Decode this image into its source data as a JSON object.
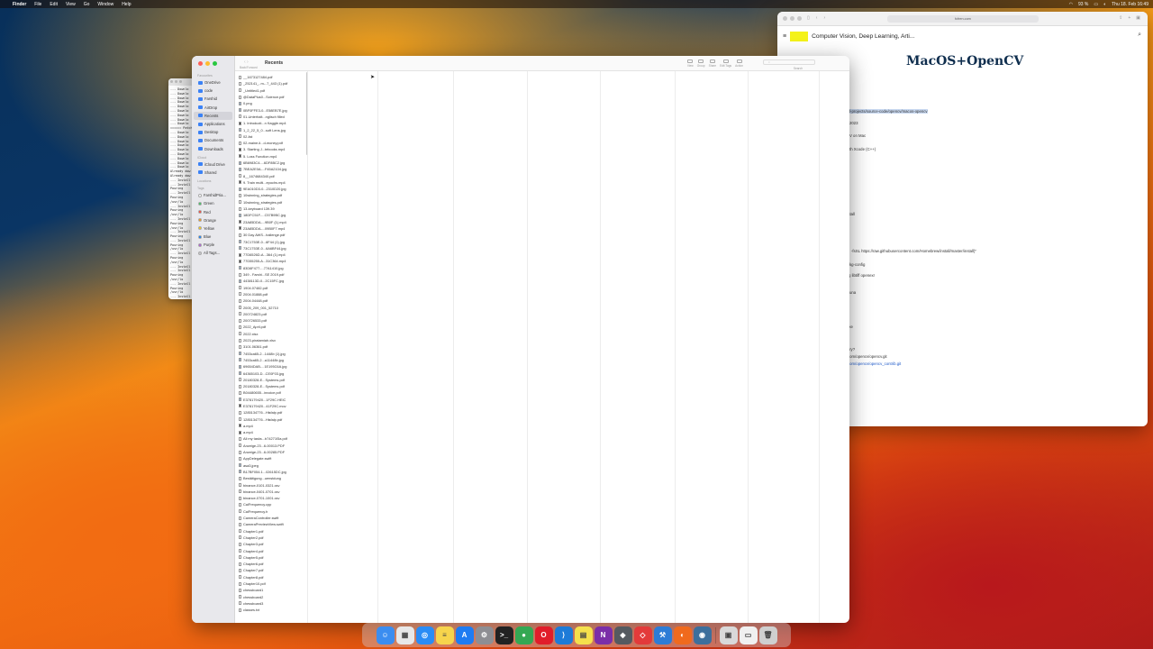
{
  "menubar": {
    "app": "Finder",
    "items": [
      "File",
      "Edit",
      "View",
      "Go",
      "Window",
      "Help"
    ],
    "battery": "93 %",
    "clock": "Thu 18. Feb 16:49"
  },
  "terminal": {
    "lines": [
      "--- Downlo",
      "--- Downlo",
      "--- Downlo",
      "--- Downlo",
      "--- Downlo",
      "--- Downlo",
      "--- Downlo",
      "--- Downlo",
      "--- Downlo",
      "====== Patchi",
      "--- Downlo",
      "--- Downlo",
      "--- Downlo",
      "--- Downlo",
      "--- Downlo",
      "--- Downlo",
      "--- Downlo",
      "--- Downlo",
      "--- Downlo",
      "Already dow",
      "Already dow",
      "--- Install",
      "--- Install",
      "Pouring",
      "--- Install",
      "Pouring",
      "/usr/lo",
      "--- Install",
      "Pouring",
      "/usr/lo",
      "--- Install",
      "Pouring",
      "/usr/lo",
      "--- Install",
      "Pouring",
      "--- Install",
      "Pouring",
      "/usr/lo",
      "--- Install",
      "Pouring",
      "/usr/lo",
      "--- Install",
      "--- Install",
      "Pouring",
      "/usr/lo",
      "--- Install",
      "Pouring",
      "/usr/lo",
      "--- Install",
      "Pouring"
    ]
  },
  "finder": {
    "title": "Recents",
    "nav_label": "Back/Forward",
    "toolbar": [
      "View",
      "Group",
      "Share",
      "Edit Tags",
      "Action"
    ],
    "search_label": "Search",
    "sidebar": {
      "favourites_header": "Favourites",
      "favourites": [
        "OneDrive",
        "code",
        "Farshid",
        "AirDrop",
        "Recents",
        "Applications",
        "Desktop",
        "Documents",
        "Downloads"
      ],
      "icloud_header": "iCloud",
      "icloud": [
        "iCloud Drive",
        "Shared"
      ],
      "locations_header": "Locations",
      "tags_header": "Tags",
      "tags": [
        {
          "label": "FarshidPria...",
          "color": "#ffffff"
        },
        {
          "label": "Green",
          "color": "#34c759"
        },
        {
          "label": "Red",
          "color": "#ff3b30"
        },
        {
          "label": "Orange",
          "color": "#ff9500"
        },
        {
          "label": "Yellow",
          "color": "#ffcc00"
        },
        {
          "label": "Blue",
          "color": "#007aff"
        },
        {
          "label": "Purple",
          "color": "#af52de"
        },
        {
          "label": "All Tags...",
          "color": "#c7c7cc"
        }
      ]
    },
    "files": [
      "__1673127484.pdf",
      "_252141_..m-..7_443 (1).pdf",
      "_Untitled1.pdf",
      "@DataPlus0...Science.pdf",
      "0.png",
      "0BF0FFE3-0...E58EB7E.jpg",
      "01-Unterhalt...nglisch filled",
      "1. Introducti...n Kaggle.mp4",
      "1_2_22_5_0...soft Lens.jpg",
      "02-list",
      "02-maine-li...d-money.pdf",
      "3. Starting J...tebooks.mp4",
      "5. Loss Function.mp4",
      "6B6983C4-...6DF8BC2.jpg",
      "7BEA2E0A-...F45A2104.jpg",
      "8__1674684340.pdf",
      "9. Train multi...epochs.mp4",
      "9EA010D3-0...2310D20.jpg",
      "10winning_strategies.pdf",
      "10winning_strategies.pdf",
      "13-keyboard 139.39",
      "18DFC51F-...C57B9BC.jpg",
      "23A85DDA-...9B0F (1).mp4",
      "23A85DDA-...09B0F7.mp4",
      "30 Day AWS...hallenge.pdf",
      "73C1753E-0...6F44 (1).jpg",
      "73C1753E-0...6A6BF44.jpg",
      "77D6526D-A...364 (1).mp4",
      "77D55255-A...31C364.mp4",
      "83D6F477-...77A1410.jpg",
      "349 - Farshi...SE 2019.pdf",
      "4438113D-0...2C15FC.jpg",
      "1904.07482.pdf",
      "2004.01888.pdf",
      "2004.04448.pdf",
      "2005_209_001_52710",
      "200724823.pdf",
      "200726533.pdf",
      "2022_April.pdf",
      "2022.xlsx",
      "2023-piratamiah.xlsx",
      "3101.06361.pdf",
      "7453ca65-2...1448b (1).jpg",
      "7453ca65-2...a11448b.jpg",
      "69654DAB-...1E195C6A.jpg",
      "64365103-D...CE0F03.jpg",
      "20180328-E...Systems.pdf",
      "20180328-E...Systems.pdf",
      "B04480655...invoice.pdf",
      "E378179420...1F29C.HEIC",
      "E378179420...41F29C.mov",
      "1285134776...Hisfalp.pdf",
      "1285134776...Hisfalp.pdf",
      "a.mp4",
      "a.mp4",
      "All my tasks...b74271f3a.pdf",
      "Anzeige-23...6-00013.PDF",
      "Anzeige-23...6-00285.PDF",
      "AppDelegate.swift",
      "asa3.jpeg",
      "B17BF054-1...02615DC.jpg",
      "Bestätigung...uenstdung",
      "binance-0101-0321.csv",
      "binance-0401-0701.csv",
      "binance-0701-1001.csv",
      "CalFrequency.cpp",
      "CalFrequency.h",
      "CameraController.swift",
      "CameraPreviewView.swift",
      "Chapter1.pdf",
      "Chapter2.pdf",
      "Chapter3.pdf",
      "Chapter4.pdf",
      "Chapter5.pdf",
      "Chapter6.pdf",
      "Chapter7.pdf",
      "Chapter8.pdf",
      "Chapter10.pdf",
      "chessboard1",
      "chessboard2",
      "chessboard3",
      "classes.txt"
    ]
  },
  "safari": {
    "url": "fcfren.com",
    "site_title": "Computer Vision, Deep Learning, Arti...",
    "heading": "MacOS+OpenCV",
    "fragments": [
      {
        "text": "/topics-and-projects/source-code/opencv/macos-opencv",
        "style": "hl"
      },
      {
        "text": "2023",
        "style": ""
      },
      {
        "text": "V on Mac",
        "style": ""
      },
      {
        "text": "th Xcode (C++)",
        "style": ""
      },
      {
        "text": "se",
        "style": ""
      },
      {
        "text": "install",
        "style": ""
      },
      {
        "text": "-fsSL https://raw.githubusercontent.com/Homebrew/install/master/install)\"",
        "style": "mix"
      },
      {
        "text": "kg-config",
        "style": ""
      },
      {
        "text": "g libtiff openexr",
        "style": ""
      },
      {
        "text": "una",
        "style": ""
      },
      {
        "text": "ake",
        "style": ""
      },
      {
        "text": "ectory?",
        "style": ""
      },
      {
        "text": "com/opencv/opencv.git",
        "style": ""
      },
      {
        "text": "com/opencv/opencv_contrib.git",
        "style": "link"
      },
      {
        "text": "or",
        "style": ""
      }
    ]
  },
  "dock": {
    "apps": [
      {
        "name": "Finder",
        "color": "#3b8df0",
        "glyph": "☺"
      },
      {
        "name": "Launchpad",
        "color": "#e8e8e8",
        "glyph": "▦"
      },
      {
        "name": "Safari",
        "color": "#2a8cf5",
        "glyph": "◎"
      },
      {
        "name": "Notes",
        "color": "#f7d44c",
        "glyph": "≡"
      },
      {
        "name": "App Store",
        "color": "#1e7cf2",
        "glyph": "A"
      },
      {
        "name": "System Settings",
        "color": "#8e8e93",
        "glyph": "⚙"
      },
      {
        "name": "Terminal",
        "color": "#222222",
        "glyph": ">_"
      },
      {
        "name": "Chrome",
        "color": "#34a853",
        "glyph": "●"
      },
      {
        "name": "Opera",
        "color": "#e11d2a",
        "glyph": "O"
      },
      {
        "name": "VS Code",
        "color": "#1d7bd8",
        "glyph": "⟩"
      },
      {
        "name": "Stickies",
        "color": "#f5e04c",
        "glyph": "▤"
      },
      {
        "name": "OneNote",
        "color": "#7b2ea8",
        "glyph": "N"
      },
      {
        "name": "Security",
        "color": "#555a60",
        "glyph": "◆"
      },
      {
        "name": "AnyDesk",
        "color": "#e33a3a",
        "glyph": "◇"
      },
      {
        "name": "Xcode",
        "color": "#2d7cd6",
        "glyph": "⚒"
      },
      {
        "name": "Firefox",
        "color": "#f06a1d",
        "glyph": "◐"
      },
      {
        "name": "Safari Tech",
        "color": "#3d6f9c",
        "glyph": "◉"
      },
      {
        "name": "Preview",
        "color": "#d9d9d9",
        "glyph": "▣"
      },
      {
        "name": "Documents",
        "color": "#f0f0f0",
        "glyph": "▭"
      },
      {
        "name": "Trash",
        "color": "#cfcfcf",
        "glyph": "🗑"
      }
    ]
  }
}
